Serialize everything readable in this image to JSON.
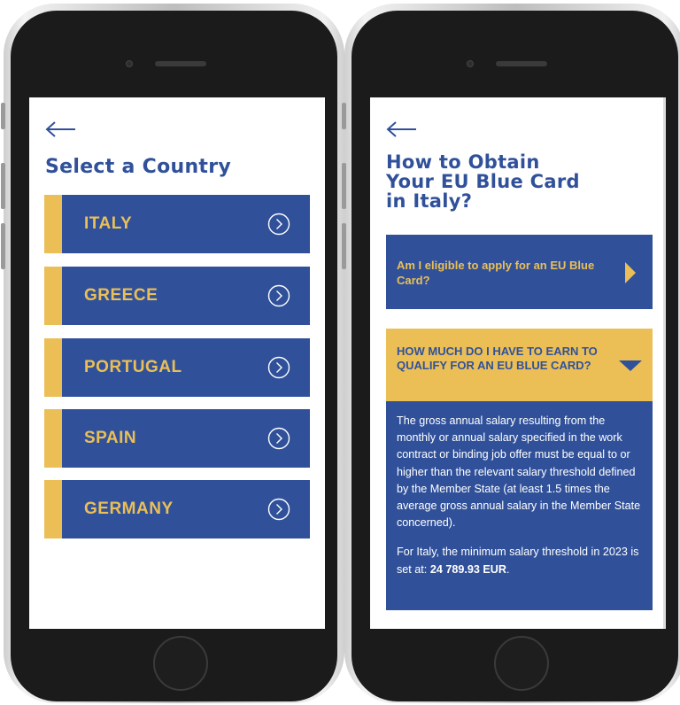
{
  "left_screen": {
    "title": "Select a Country",
    "countries": [
      {
        "label": "ITALY"
      },
      {
        "label": "GREECE"
      },
      {
        "label": "PORTUGAL"
      },
      {
        "label": "SPAIN"
      },
      {
        "label": "GERMANY"
      }
    ]
  },
  "right_screen": {
    "title_line1": "How to Obtain",
    "title_line2": "Your EU Blue Card",
    "title_line3": "in Italy?",
    "faq_collapsed": {
      "question": "Am I eligible to apply for an EU Blue Card?"
    },
    "faq_expanded": {
      "question": "HOW MUCH DO I HAVE TO EARN TO QUALIFY FOR AN EU BLUE CARD?",
      "answer_p1": "The gross annual salary resulting from the monthly or annual salary specified in the work contract or binding job offer must be equal to or higher than the relevant salary threshold defined by the Member State (at least 1.5 times the average gross annual salary in the Member State concerned).",
      "answer_p2_prefix": "For Italy, the minimum salary threshold in 2023 is set at: ",
      "answer_p2_amount": "24 789.93 EUR",
      "answer_p2_suffix": "."
    }
  },
  "colors": {
    "brand_blue": "#30519a",
    "brand_yellow": "#ebbf56",
    "screen_bg": "#ffffff",
    "phone_body": "#1b1b1b"
  },
  "icons": {
    "back": "arrow-left-icon",
    "country_chevron": "chevron-right-circle-icon",
    "collapsed_indicator": "triangle-right-icon",
    "expanded_indicator": "triangle-down-icon"
  }
}
